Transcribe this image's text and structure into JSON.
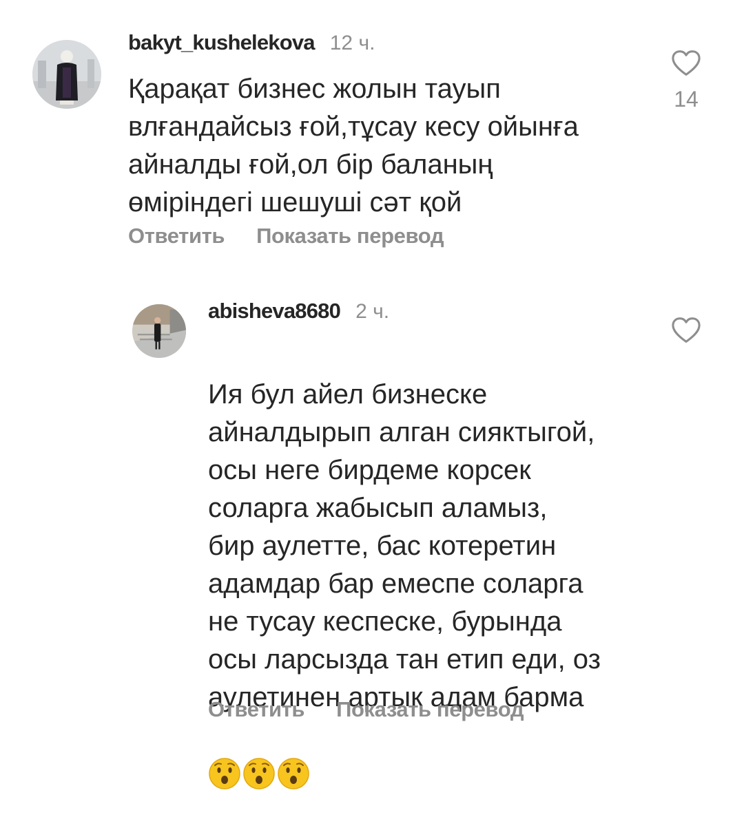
{
  "comments": [
    {
      "username": "bakyt_kushelekova",
      "time": "12 ч.",
      "text": "Қарақат бизнес жолын тауып\nвлғандайсыз ғой,тұсау кесу ойынға\nайналды ғой,ол бір  баланың\nөміріндегі шешуші сәт қой",
      "likes": "14",
      "reply_label": "Ответить",
      "translate_label": "Показать перевод",
      "icons": {
        "like": "heart-outline-icon"
      }
    },
    {
      "username": "abisheva8680",
      "time": "2 ч.",
      "text": "Ия бул айел бизнеске\nайналдырып алган сияктыгой,\nосы неге бирдеме корсек\nсоларга жабысып аламыз,\nбир аулетте, бас котеретин\nадамдар бар емеспе соларга\nне тусау кеспеске, бурында\nосы ларсызда тан етип еди, оз\nаулетинен артык адам барма",
      "emojis": [
        "😯",
        "😯",
        "😯"
      ],
      "reply_label": "Ответить",
      "translate_label": "Показать перевод",
      "icons": {
        "like": "heart-outline-icon",
        "emoji": "hushed-face-emoji"
      }
    }
  ],
  "colors": {
    "primary_text": "#262626",
    "secondary_text": "#8e8e8e",
    "emoji_face": "#f7c51e"
  }
}
